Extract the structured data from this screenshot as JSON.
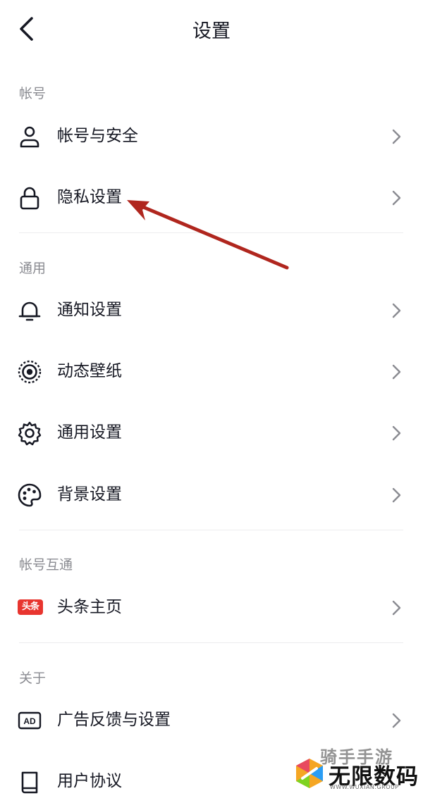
{
  "header": {
    "title": "设置",
    "back_icon": "chevron-left-icon"
  },
  "sections": [
    {
      "title": "帐号",
      "items": [
        {
          "label": "帐号与安全",
          "icon": "user-icon"
        },
        {
          "label": "隐私设置",
          "icon": "lock-icon"
        }
      ]
    },
    {
      "title": "通用",
      "items": [
        {
          "label": "通知设置",
          "icon": "bell-icon"
        },
        {
          "label": "动态壁纸",
          "icon": "live-wallpaper-icon"
        },
        {
          "label": "通用设置",
          "icon": "gear-icon"
        },
        {
          "label": "背景设置",
          "icon": "palette-icon"
        }
      ]
    },
    {
      "title": "帐号互通",
      "items": [
        {
          "label": "头条主页",
          "icon": "toutiao-icon",
          "badge_text": "头条"
        }
      ]
    },
    {
      "title": "关于",
      "items": [
        {
          "label": "广告反馈与设置",
          "icon": "ad-icon",
          "icon_text": "AD"
        },
        {
          "label": "用户协议",
          "icon": "book-icon"
        }
      ]
    }
  ],
  "watermark": {
    "top_text": "骑手手游",
    "main_text": "无限数码",
    "url_text": "WWW.WUXIAN.GROUP"
  },
  "colors": {
    "text": "#161823",
    "secondary": "#8a8b91",
    "divider": "#ececee",
    "annotation_arrow": "#b0261e",
    "toutiao_red": "#e8352f"
  }
}
